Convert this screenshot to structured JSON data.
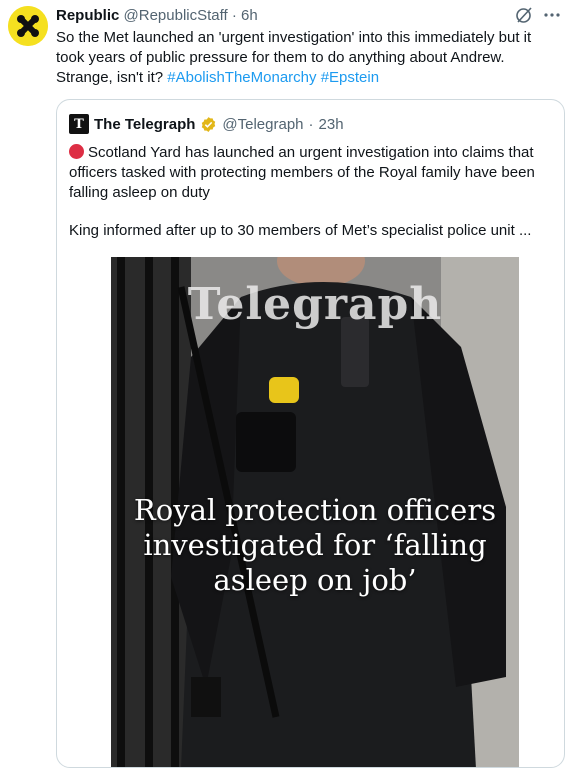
{
  "tweet": {
    "author_name": "Republic",
    "author_handle": "@RepublicStaff",
    "separator": "·",
    "time": "6h",
    "text_main": "So the Met launched an 'urgent investigation' into this immediately but it took years of public pressure for them to do anything about Andrew. Strange, isn't it? ",
    "hashtag_1": "#AbolishTheMonarchy",
    "hashtag_2": "#Epstein",
    "avatar_icon": "republic-x-logo",
    "grok_icon": "grok-icon",
    "more_icon": "more-dots-icon"
  },
  "quote": {
    "author_name": "The Telegraph",
    "author_handle": "@Telegraph",
    "separator": "·",
    "time": "23h",
    "logo_letter": "T",
    "verified_color": "#e2b719",
    "text": "Scotland Yard has launched an urgent investigation into claims that officers tasked with protecting members of the Royal family have been falling asleep on duty",
    "description": "King informed after up to 30 members of Met’s specialist police unit ...",
    "image": {
      "masthead": "Telegraph",
      "headline_line_1": "Royal protection officers",
      "headline_line_2": "investigated for ‘falling",
      "headline_line_3": "asleep on job’"
    }
  },
  "colors": {
    "hashtag": "#1d9bf0",
    "avatar_bg": "#f5e020",
    "alert_dot": "#dd2e44"
  }
}
